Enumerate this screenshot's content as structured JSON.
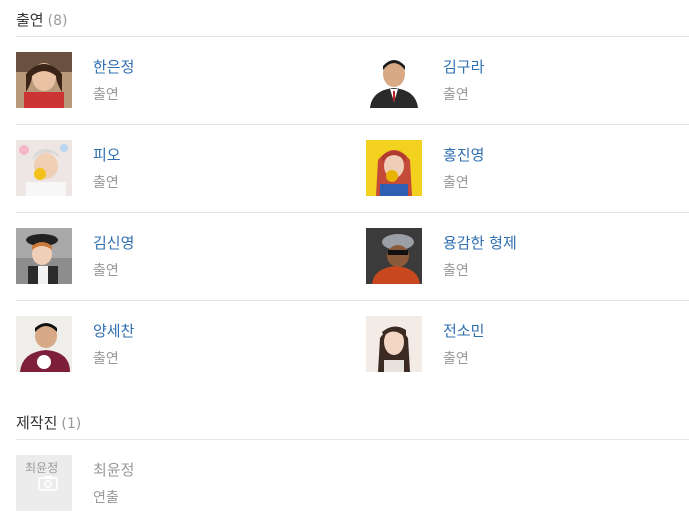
{
  "cast": {
    "title": "출연",
    "count": "(8)",
    "people": [
      {
        "name": "한은정",
        "role": "출연"
      },
      {
        "name": "김구라",
        "role": "출연"
      },
      {
        "name": "피오",
        "role": "출연"
      },
      {
        "name": "홍진영",
        "role": "출연"
      },
      {
        "name": "김신영",
        "role": "출연"
      },
      {
        "name": "용감한 형제",
        "role": "출연"
      },
      {
        "name": "양세찬",
        "role": "출연"
      },
      {
        "name": "전소민",
        "role": "출연"
      }
    ]
  },
  "crew": {
    "title": "제작진",
    "count": "(1)",
    "people": [
      {
        "name": "최윤정",
        "role": "연출",
        "placeholder_text": "최윤정",
        "placeholder_icon": "camera-icon"
      }
    ]
  },
  "colors": {
    "link": "#2f6fb0",
    "muted": "#999999",
    "divider": "#e6e6e6"
  }
}
